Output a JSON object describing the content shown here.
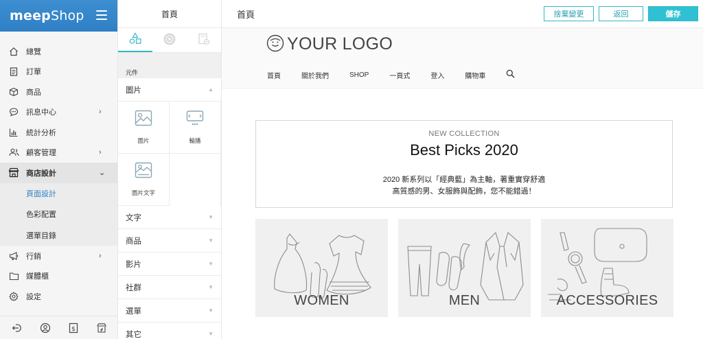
{
  "brand": {
    "name_bold": "meep",
    "name_light": "Shop"
  },
  "sidebar": {
    "items": [
      {
        "label": "總覽"
      },
      {
        "label": "訂單"
      },
      {
        "label": "商品"
      },
      {
        "label": "訊息中心",
        "caret": "›"
      },
      {
        "label": "統計分析"
      },
      {
        "label": "顧客管理",
        "caret": "›"
      },
      {
        "label": "商店設計",
        "caret": "⌄"
      },
      {
        "label": "行銷",
        "caret": "›"
      },
      {
        "label": "媒體櫃"
      },
      {
        "label": "設定"
      }
    ],
    "subitems": [
      {
        "label": "頁面設計"
      },
      {
        "label": "色彩配置"
      },
      {
        "label": "選單目錄"
      }
    ]
  },
  "panel": {
    "title": "首頁",
    "section_label": "元件",
    "image_group": "圖片",
    "tiles": [
      {
        "label": "圖片"
      },
      {
        "label": "輪播"
      },
      {
        "label": "圖片文字"
      }
    ],
    "groups": [
      {
        "label": "文字"
      },
      {
        "label": "商品"
      },
      {
        "label": "影片"
      },
      {
        "label": "社群"
      },
      {
        "label": "選單"
      },
      {
        "label": "其它"
      }
    ]
  },
  "topbar": {
    "page_title": "首頁",
    "discard_label": "捨棄變更",
    "back_label": "返回",
    "save_label": "儲存"
  },
  "site": {
    "logo_text": "YOUR LOGO",
    "nav": [
      "首頁",
      "關於我們",
      "SHOP",
      "一頁式",
      "登入",
      "購物車"
    ]
  },
  "hero": {
    "eyebrow": "NEW COLLECTION",
    "title": "Best Picks 2020",
    "line1": "2020 新系列以「經典藍」為主軸，著重實穿舒適",
    "line2": "高質感的男、女服飾與配飾，您不能錯過！"
  },
  "categories": [
    {
      "label": "WOMEN"
    },
    {
      "label": "MEN"
    },
    {
      "label": "ACCESSORIES"
    }
  ],
  "colors": {
    "brand": "#2f7fc4",
    "accent": "#30c0d3",
    "link": "#2f7fc4"
  },
  "icons": {
    "sidebar": [
      "home-icon",
      "clipboard-icon",
      "box-icon",
      "chat-icon",
      "bar-chart-icon",
      "users-icon",
      "store-icon",
      "megaphone-icon",
      "folder-icon",
      "gear-icon"
    ]
  }
}
